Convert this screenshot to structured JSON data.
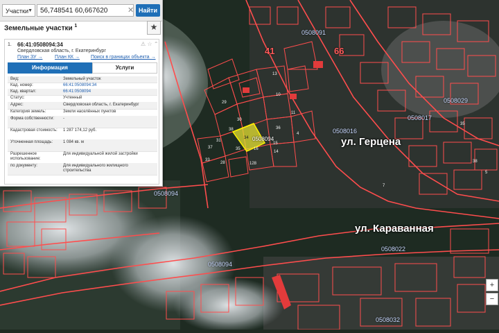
{
  "search": {
    "layer": "Участки",
    "query": "56,748541 60,667620",
    "find_label": "Найти"
  },
  "panel": {
    "title": "Земельные участки",
    "title_count": "1",
    "item_index": "1.",
    "cad_number": "66:41:0508094:34",
    "address_short": "Свердловская область, г. Екатеринбург",
    "links": [
      "План ЗУ →",
      "План КК →",
      "Поиск в границах объекта →"
    ],
    "tabs": [
      "Информация",
      "Услуги"
    ],
    "attributes": [
      {
        "k": "Вид:",
        "v": "Земельный участок"
      },
      {
        "k": "Кад. номер:",
        "v": "66:41:0508094:34"
      },
      {
        "k": "Кад. квартал:",
        "v": "66:41:0508094"
      },
      {
        "k": "Статус:",
        "v": "Учтенный"
      },
      {
        "k": "Адрес:",
        "v": "Свердловская область, г. Екатеринбург"
      },
      {
        "k": "Категория земель:",
        "v": "Земли населённых пунктов"
      },
      {
        "k": "Форма собственности:",
        "v": "-"
      },
      {
        "k": "Кадастровая стоимость:",
        "v": "1 287 174,12 руб."
      },
      {
        "k": "Уточненная площадь:",
        "v": "1 084 кв. м"
      },
      {
        "k": "Разрешенное использование:",
        "v": "Для индивидуальной жилой застройки"
      },
      {
        "k": "по документу:",
        "v": "Для индивидуального жилищного строительства"
      }
    ]
  },
  "map": {
    "streets": [
      "ул. Герцена",
      "ул. Караванная"
    ],
    "quarter_labels": [
      "0508091",
      "0508016",
      "0508094",
      "0508094",
      "0508094",
      "0508022",
      "0508029",
      "0508017",
      "0508032"
    ],
    "quarter_numbers": [
      "41",
      "66"
    ],
    "parcel_numbers": [
      "13",
      "10",
      "29",
      "30",
      "11",
      "34",
      "35",
      "36",
      "31",
      "33",
      "4",
      "15",
      "37",
      "38",
      "28",
      "16",
      "14",
      "128",
      "7",
      "5",
      "35",
      "38"
    ],
    "selected_parcel": "34",
    "zoom_controls": [
      "+",
      "−"
    ]
  },
  "colors": {
    "accent": "#1f6fb7",
    "boundary": "#ff4d4d",
    "selected_fill": "#e6e233"
  }
}
